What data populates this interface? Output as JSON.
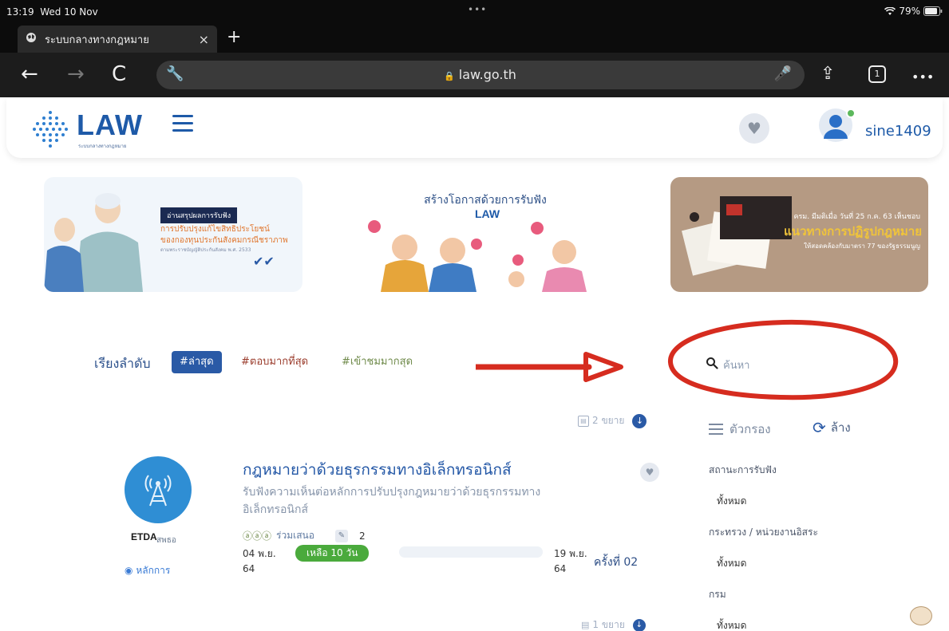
{
  "status_bar": {
    "time": "13:19",
    "date": "Wed 10 Nov",
    "battery": "79%"
  },
  "browser": {
    "tab_title": "ระบบกลางทางกฎหมาย",
    "tab_close": "×",
    "new_tab": "+",
    "url": "law.go.th",
    "tab_count": "1",
    "more": "•••"
  },
  "header": {
    "logo_text": "LAW",
    "logo_subtitle": "ระบบกลางทางกฎหมาย",
    "username": "sine1409"
  },
  "banners": [
    {
      "badge": "อ่านสรุปผลการรับฟัง",
      "line1": "การปรับปรุงแก้ไขสิทธิประโยชน์",
      "line2": "ของกองทุนประกันสังคมกรณีชราภาพ",
      "line3": "ตามพระราชบัญญัติประกันสังคม พ.ศ. 2533"
    },
    {
      "title": "สร้างโอกาสด้วยการรับฟัง",
      "logo": "LAW"
    },
    {
      "line1": "ครม. มีมติเมื่อ วันที่ 25 ก.ค. 63 เห็นชอบ",
      "line2": "แนวทางการปฏิรูปกฎหมาย",
      "line3": "ให้สอดคล้องกับมาตรา 77 ของรัฐธรรมนูญ"
    }
  ],
  "sort": {
    "label": "เรียงลำดับ",
    "options": [
      "#ล่าสุด",
      "#ตอบมากที่สุด",
      "#เข้าชมมากสุด"
    ]
  },
  "search": {
    "placeholder": "ค้นหา"
  },
  "results": {
    "expand_all": "2 ขยาย",
    "items": [
      {
        "agency": "ETDA",
        "agency_sub": "สพธอ",
        "principle": "หลักการ",
        "title": "กฎหมายว่าด้วยธุรกรรมทางอิเล็กทรอนิกส์",
        "desc_line1": "รับฟังความเห็นต่อหลักการปรับปรุงกฎหมายว่าด้วยธุรกรรมทาง",
        "desc_line2": "อิเล็กทรอนิกส์",
        "participants_label": "ร่วมเสนอ",
        "comment_count": "2",
        "start_date_1": "04 พ.ย.",
        "start_date_2": "64",
        "remaining": "เหลือ 10 วัน",
        "end_date_1": "19 พ.ย.",
        "end_date_2": "64",
        "round": "ครั้งที่ 02"
      }
    ],
    "expand_one": "1 ขยาย"
  },
  "filters": {
    "title": "ตัวกรอง",
    "clear": "ล้าง",
    "groups": [
      {
        "label": "สถานะการรับฟัง",
        "value": "ทั้งหมด"
      },
      {
        "label": "กระทรวง / หน่วยงานอิสระ",
        "value": "ทั้งหมด"
      },
      {
        "label": "กรม",
        "value": "ทั้งหมด"
      }
    ]
  }
}
